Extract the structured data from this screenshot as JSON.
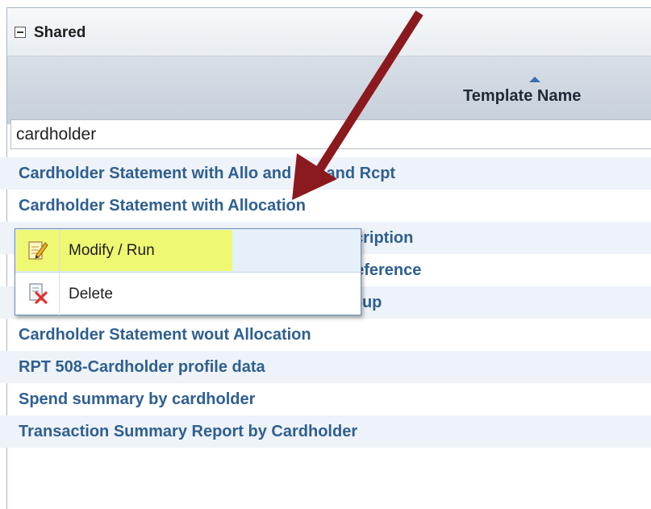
{
  "panel": {
    "title": "Shared"
  },
  "grid": {
    "column_header": "Template Name",
    "filter_value": "cardholder",
    "rows": [
      "Cardholder Statement with Allo and Ref and Rcpt",
      "Cardholder Statement with Allocation",
      "Cardholder Statement with Allocation & description",
      "Cardholder Statement with Allocation and Reference",
      "Cardholder Statement with Allocation by Group",
      "Cardholder Statement wout Allocation",
      "RPT 508-Cardholder profile data",
      "Spend summary by cardholder",
      "Transaction Summary Report by Cardholder"
    ]
  },
  "context_menu": {
    "modify_run_label": "Modify / Run",
    "delete_label": "Delete",
    "modify_icon": "edit-document-icon",
    "delete_icon": "delete-document-icon"
  },
  "colors": {
    "link_text": "#2f5f91",
    "highlight": "#eef95a",
    "annotation_arrow": "#8b1a1f"
  }
}
